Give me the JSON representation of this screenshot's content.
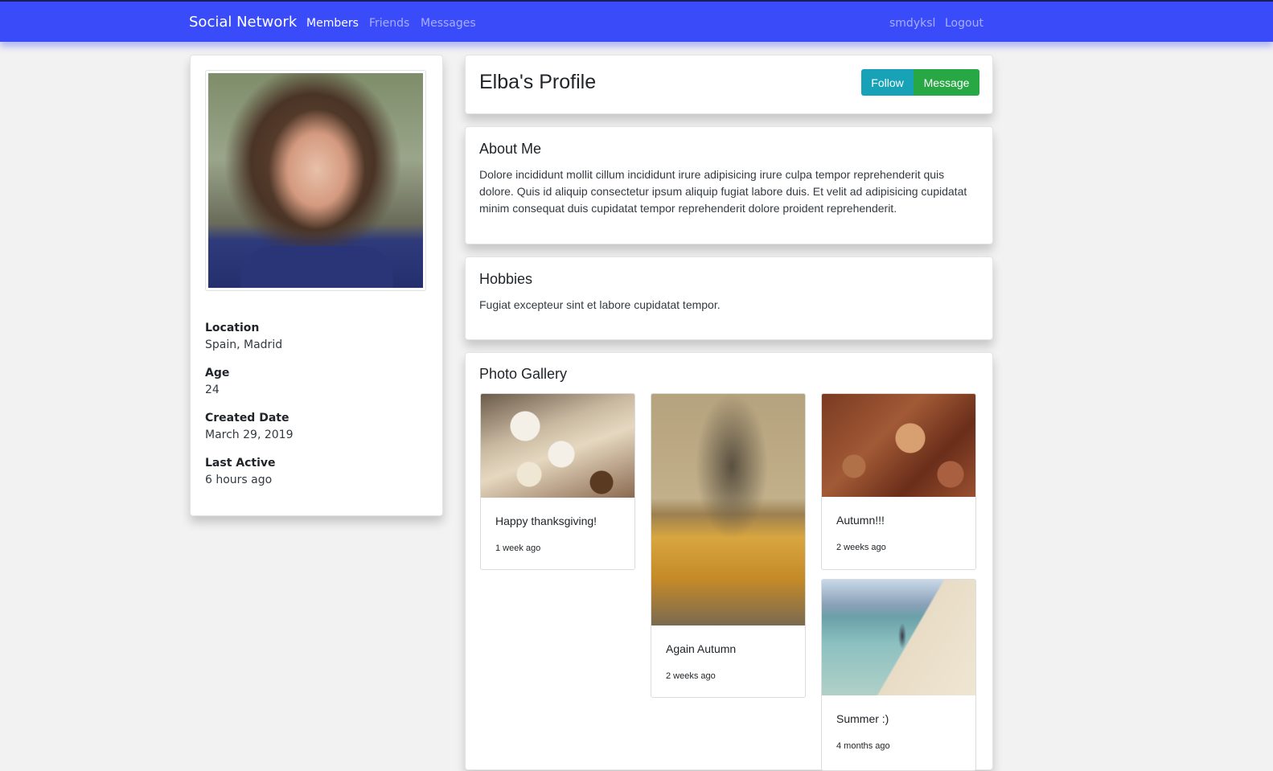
{
  "navbar": {
    "brand": "Social Network",
    "links": [
      "Members",
      "Friends",
      "Messages"
    ],
    "username": "smdyksl",
    "logout": "Logout"
  },
  "profile": {
    "title": "Elba's Profile",
    "follow_label": "Follow",
    "message_label": "Message",
    "info": [
      {
        "label": "Location",
        "value": "Spain, Madrid"
      },
      {
        "label": "Age",
        "value": "24"
      },
      {
        "label": "Created Date",
        "value": "March 29, 2019"
      },
      {
        "label": "Last Active",
        "value": "6 hours ago"
      }
    ]
  },
  "about": {
    "title": "About Me",
    "text": "Dolore incididunt mollit cillum incididunt irure adipisicing irure culpa tempor reprehenderit quis dolore. Quis id aliquip consectetur ipsum aliquip fugiat labore duis. Et velit ad adipisicing cupidatat minim consequat duis cupidatat tempor reprehenderit dolore proident reprehenderit."
  },
  "hobbies": {
    "title": "Hobbies",
    "text": "Fugiat excepteur sint et labore cupidatat tempor."
  },
  "gallery": {
    "title": "Photo Gallery",
    "photos": [
      {
        "caption": "Happy thanksgiving!",
        "time": "1 week ago"
      },
      {
        "caption": "Again Autumn",
        "time": "2 weeks ago"
      },
      {
        "caption": "Autumn!!!",
        "time": "2 weeks ago"
      },
      {
        "caption": "Summer :)",
        "time": "4 months ago"
      }
    ]
  },
  "colors": {
    "navbar": "#3a4bf9",
    "follow": "#17a2b8",
    "message": "#28a745",
    "background": "#f2f2f2"
  }
}
